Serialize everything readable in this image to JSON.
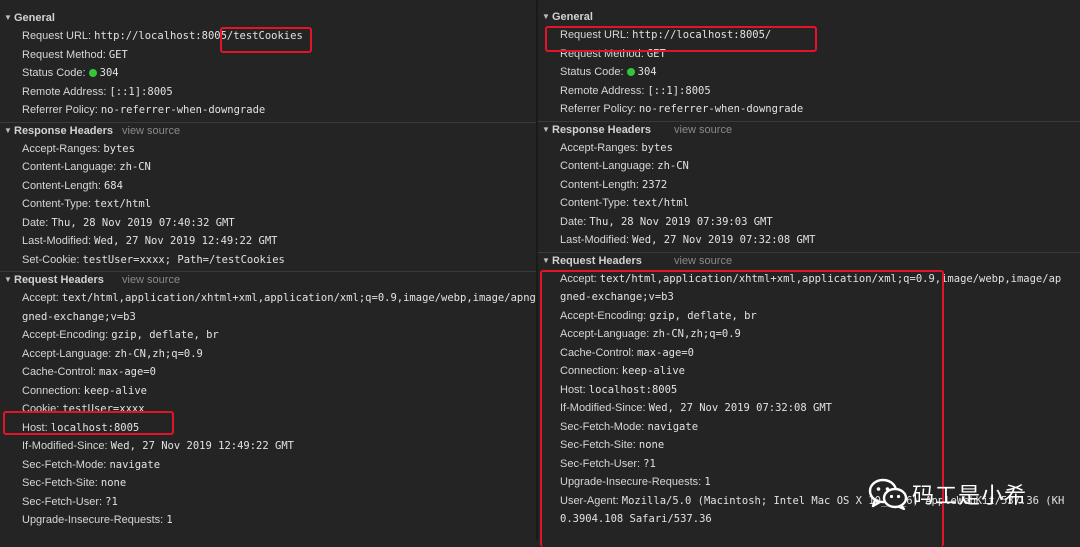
{
  "left": {
    "general": {
      "title": "General",
      "rows": [
        {
          "k": "Request URL:",
          "v": "http://localhost:8005/testCookies"
        },
        {
          "k": "Request Method:",
          "v": "GET"
        },
        {
          "k": "Status Code:",
          "v": "304",
          "status": "green"
        },
        {
          "k": "Remote Address:",
          "v": "[::1]:8005"
        },
        {
          "k": "Referrer Policy:",
          "v": "no-referrer-when-downgrade"
        }
      ]
    },
    "response_headers": {
      "title": "Response Headers",
      "view_source": "view source",
      "rows": [
        {
          "k": "Accept-Ranges:",
          "v": "bytes"
        },
        {
          "k": "Content-Language:",
          "v": "zh-CN"
        },
        {
          "k": "Content-Length:",
          "v": "684"
        },
        {
          "k": "Content-Type:",
          "v": "text/html"
        },
        {
          "k": "Date:",
          "v": "Thu, 28 Nov 2019 07:40:32 GMT"
        },
        {
          "k": "Last-Modified:",
          "v": "Wed, 27 Nov 2019 12:49:22 GMT"
        },
        {
          "k": "Set-Cookie:",
          "v": "testUser=xxxx; Path=/testCookies"
        }
      ]
    },
    "request_headers": {
      "title": "Request Headers",
      "view_source": "view source",
      "rows": [
        {
          "k": "Accept:",
          "v": "text/html,application/xhtml+xml,application/xml;q=0.9,image/webp,image/apng,*/"
        },
        {
          "k": "",
          "v": "gned-exchange;v=b3"
        },
        {
          "k": "Accept-Encoding:",
          "v": "gzip, deflate, br"
        },
        {
          "k": "Accept-Language:",
          "v": "zh-CN,zh;q=0.9"
        },
        {
          "k": "Cache-Control:",
          "v": "max-age=0"
        },
        {
          "k": "Connection:",
          "v": "keep-alive"
        },
        {
          "k": "Cookie:",
          "v": "testUser=xxxx"
        },
        {
          "k": "Host:",
          "v": "localhost:8005"
        },
        {
          "k": "If-Modified-Since:",
          "v": "Wed, 27 Nov 2019 12:49:22 GMT"
        },
        {
          "k": "Sec-Fetch-Mode:",
          "v": "navigate"
        },
        {
          "k": "Sec-Fetch-Site:",
          "v": "none"
        },
        {
          "k": "Sec-Fetch-User:",
          "v": "?1"
        },
        {
          "k": "Upgrade-Insecure-Requests:",
          "v": "1"
        }
      ]
    }
  },
  "right": {
    "general": {
      "title": "General",
      "rows": [
        {
          "k": "Request URL:",
          "v": "http://localhost:8005/"
        },
        {
          "k": "Request Method:",
          "v": "GET"
        },
        {
          "k": "Status Code:",
          "v": "304",
          "status": "green"
        },
        {
          "k": "Remote Address:",
          "v": "[::1]:8005"
        },
        {
          "k": "Referrer Policy:",
          "v": "no-referrer-when-downgrade"
        }
      ]
    },
    "response_headers": {
      "title": "Response Headers",
      "view_source": "view source",
      "rows": [
        {
          "k": "Accept-Ranges:",
          "v": "bytes"
        },
        {
          "k": "Content-Language:",
          "v": "zh-CN"
        },
        {
          "k": "Content-Length:",
          "v": "2372"
        },
        {
          "k": "Content-Type:",
          "v": "text/html"
        },
        {
          "k": "Date:",
          "v": "Thu, 28 Nov 2019 07:39:03 GMT"
        },
        {
          "k": "Last-Modified:",
          "v": "Wed, 27 Nov 2019 07:32:08 GMT"
        }
      ]
    },
    "request_headers": {
      "title": "Request Headers",
      "view_source": "view source",
      "rows": [
        {
          "k": "Accept:",
          "v": "text/html,application/xhtml+xml,application/xml;q=0.9,image/webp,image/ap"
        },
        {
          "k": "",
          "v": "gned-exchange;v=b3"
        },
        {
          "k": "Accept-Encoding:",
          "v": "gzip, deflate, br"
        },
        {
          "k": "Accept-Language:",
          "v": "zh-CN,zh;q=0.9"
        },
        {
          "k": "Cache-Control:",
          "v": "max-age=0"
        },
        {
          "k": "Connection:",
          "v": "keep-alive"
        },
        {
          "k": "Host:",
          "v": "localhost:8005"
        },
        {
          "k": "If-Modified-Since:",
          "v": "Wed, 27 Nov 2019 07:32:08 GMT"
        },
        {
          "k": "Sec-Fetch-Mode:",
          "v": "navigate"
        },
        {
          "k": "Sec-Fetch-Site:",
          "v": "none"
        },
        {
          "k": "Sec-Fetch-User:",
          "v": "?1"
        },
        {
          "k": "Upgrade-Insecure-Requests:",
          "v": "1"
        },
        {
          "k": "User-Agent:",
          "v": "Mozilla/5.0 (Macintosh; Intel Mac OS X 10_14_6) AppleWebKit/537.36 (KH"
        },
        {
          "k": "",
          "v": "0.3904.108 Safari/537.36"
        }
      ]
    }
  },
  "watermark": {
    "text": "码工是小希",
    "icon": "wechat-icon"
  },
  "colors": {
    "highlight": "#e3142a",
    "status_ok": "#35c53a",
    "background": "#242424"
  }
}
